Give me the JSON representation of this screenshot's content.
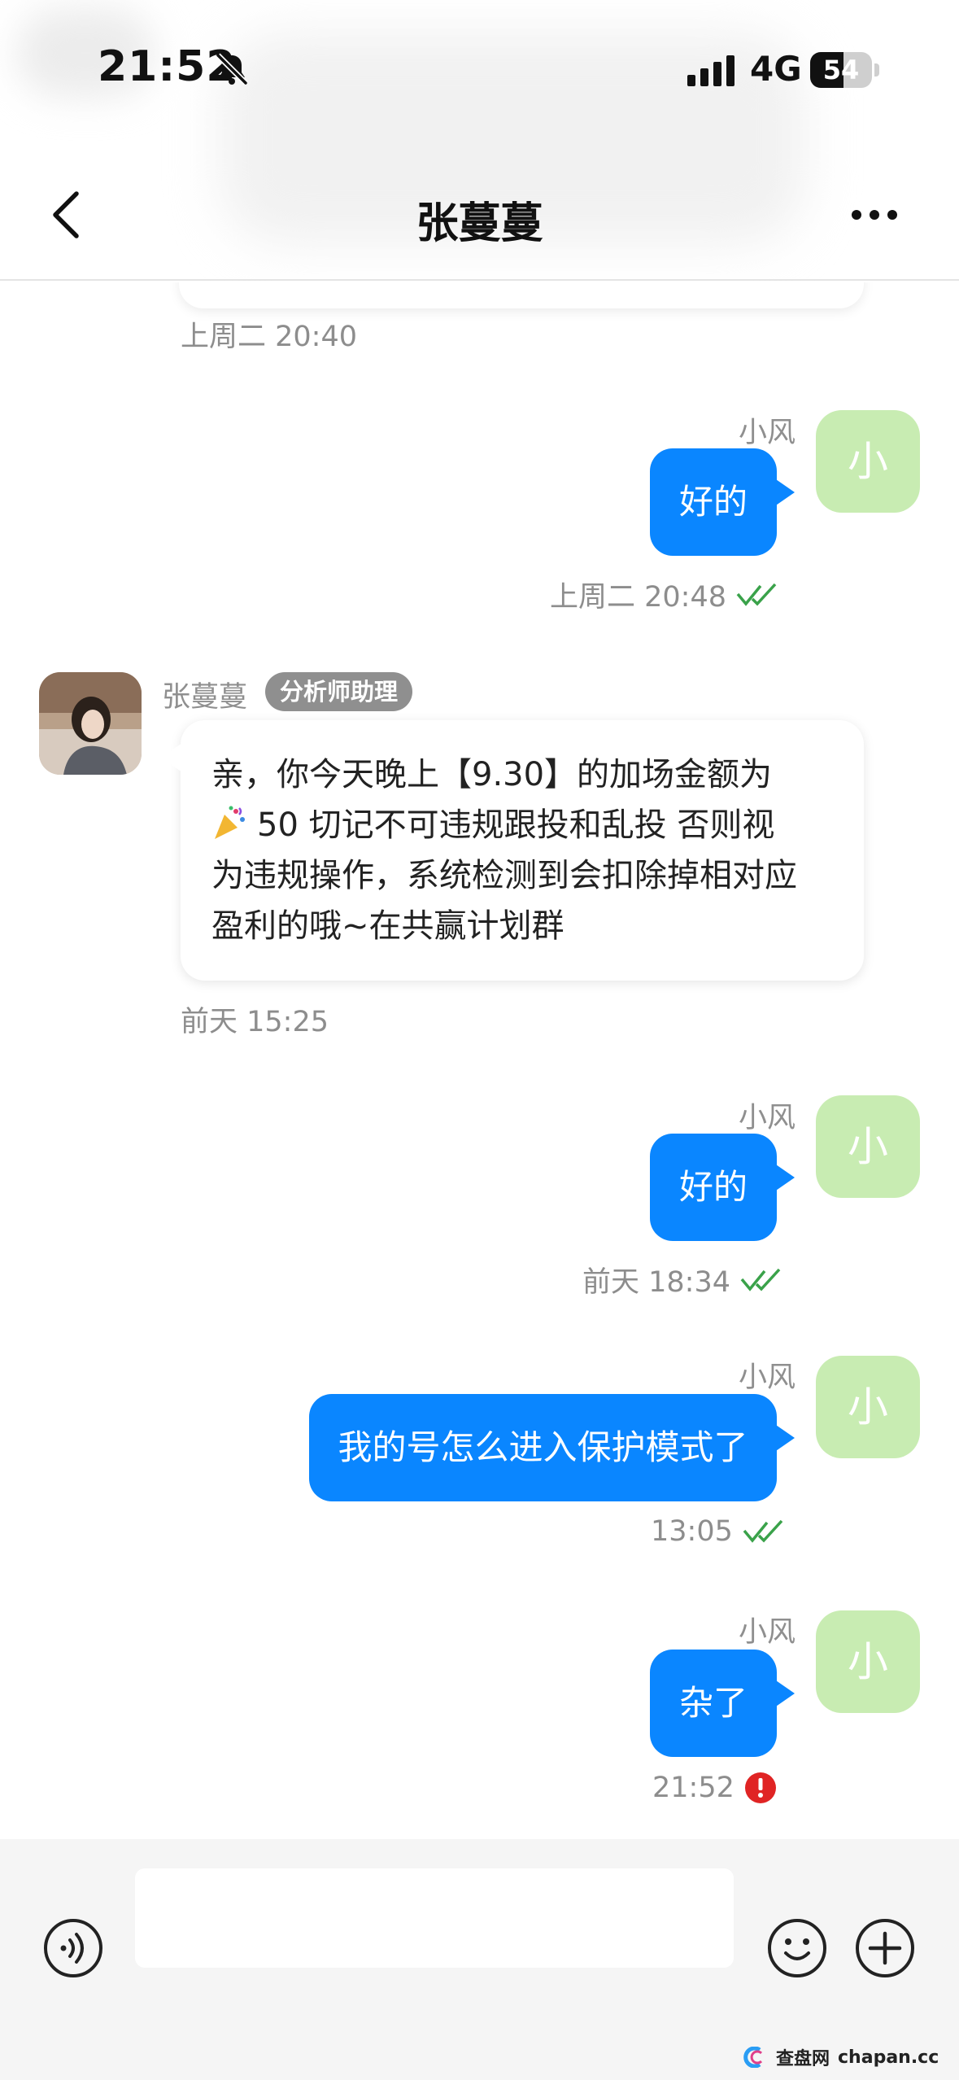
{
  "status_bar": {
    "time": "21:52",
    "network": "4G",
    "battery": "54",
    "battery_level": 0.54
  },
  "header": {
    "title": "张蔓蔓"
  },
  "messages": [
    {
      "sender": "",
      "time": "上周二 20:40"
    },
    {
      "sender": "小风",
      "avatar": "小",
      "text": "好的",
      "time": "上周二 20:48"
    },
    {
      "sender": "张蔓蔓",
      "role": "分析师助理",
      "lines": [
        "亲，你今天晚上【9.30】的加场金额为",
        "50 切记不可违规跟投和乱投 否则视",
        "为违规操作，系统检测到会扣除掉相对应",
        "盈利的哦~在共赢计划群"
      ],
      "time": "前天 15:25"
    },
    {
      "sender": "小风",
      "avatar": "小",
      "text": "好的",
      "time": "前天 18:34"
    },
    {
      "sender": "小风",
      "avatar": "小",
      "text": "我的号怎么进入保护模式了",
      "time": "13:05"
    },
    {
      "sender": "小风",
      "avatar": "小",
      "text": "杂了",
      "time": "21:52"
    }
  ],
  "input": {
    "placeholder": "",
    "value": ""
  },
  "watermark": {
    "brand": "查盘网",
    "domain": "chapan.cc"
  },
  "colors": {
    "accent": "#0a86ff",
    "my_avatar": "#c8ecb2",
    "read_tick": "#3aa24a",
    "error": "#e02424"
  }
}
